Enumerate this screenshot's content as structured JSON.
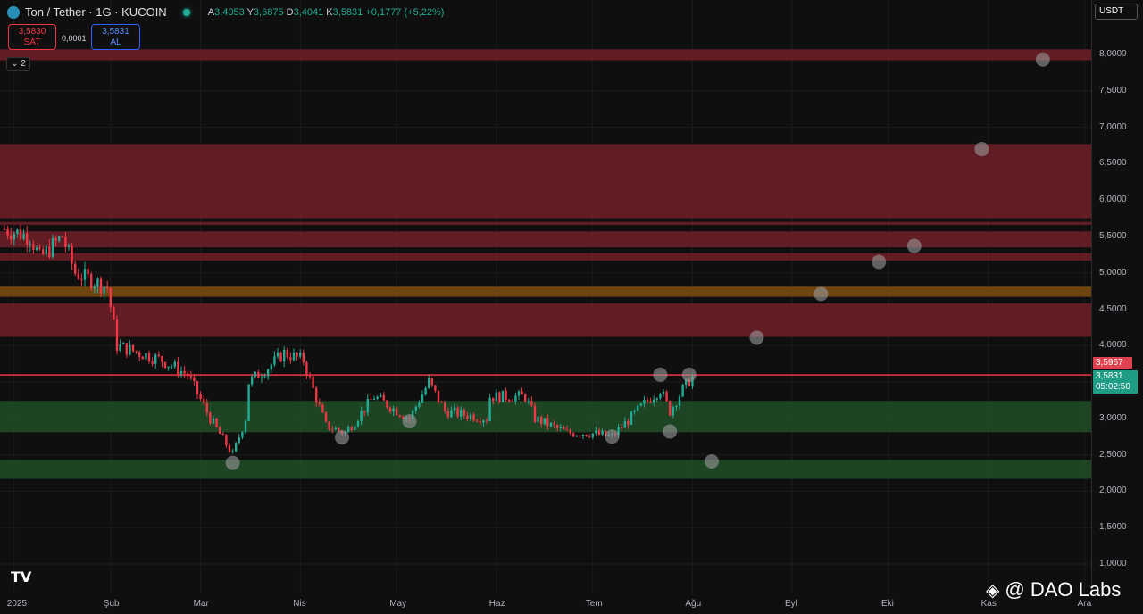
{
  "header": {
    "symbol": "Ton / Tether · 1G · KUCOIN",
    "open_label": "A",
    "open": "3,4053",
    "high_label": "Y",
    "high": "3,6875",
    "low_label": "D",
    "low": "3,4041",
    "close_label": "K",
    "close": "3,5831",
    "change": "+0,1777 (+5,22%)"
  },
  "trade": {
    "sell_price": "3,5830",
    "sell_label": "SAT",
    "spread": "0,0001",
    "buy_price": "3,5831",
    "buy_label": "AL"
  },
  "indicators_toggle": "2",
  "currency": "USDT",
  "price_tags": {
    "line": "3,5967",
    "last": "3,5831",
    "countdown": "05:02:50"
  },
  "watermark": "@ DAO Labs",
  "colors": {
    "up": "#22ab94",
    "down": "#f23645",
    "red_zone": "#6b1f27",
    "green_zone": "#1f4a26",
    "orange_zone": "#7a4a10"
  },
  "chart_data": {
    "type": "candlestick",
    "y_ticks": [
      "8,0000",
      "7,5000",
      "7,0000",
      "6,5000",
      "6,0000",
      "5,5000",
      "5,0000",
      "4,5000",
      "4,0000",
      "3,5000",
      "3,0000",
      "2,5000",
      "2,0000",
      "1,5000",
      "1,0000"
    ],
    "ylim": [
      1.0,
      8.0
    ],
    "x_ticks": [
      {
        "label": "2025",
        "day": 3
      },
      {
        "label": "Şub",
        "day": 33
      },
      {
        "label": "Mar",
        "day": 61
      },
      {
        "label": "Nis",
        "day": 92
      },
      {
        "label": "May",
        "day": 122
      },
      {
        "label": "Haz",
        "day": 153
      },
      {
        "label": "Tem",
        "day": 183
      },
      {
        "label": "Ağu",
        "day": 214
      },
      {
        "label": "Eyl",
        "day": 245
      },
      {
        "label": "Eki",
        "day": 275
      },
      {
        "label": "Kas",
        "day": 306
      },
      {
        "label": "Ara",
        "day": 336
      }
    ],
    "path": [
      [
        0,
        5.6
      ],
      [
        8,
        5.5
      ],
      [
        11,
        5.2
      ],
      [
        18,
        5.5
      ],
      [
        22,
        5.0
      ],
      [
        32,
        4.8
      ],
      [
        35,
        4.0
      ],
      [
        49,
        3.8
      ],
      [
        57,
        3.6
      ],
      [
        64,
        3.0
      ],
      [
        71,
        2.5
      ],
      [
        75,
        3.0
      ],
      [
        76,
        3.5
      ],
      [
        82,
        3.7
      ],
      [
        87,
        3.9
      ],
      [
        93,
        3.8
      ],
      [
        96,
        3.4
      ],
      [
        100,
        2.9
      ],
      [
        106,
        2.8
      ],
      [
        115,
        3.3
      ],
      [
        126,
        3.0
      ],
      [
        132,
        3.5
      ],
      [
        137,
        3.1
      ],
      [
        150,
        3.0
      ],
      [
        151,
        3.3
      ],
      [
        162,
        3.3
      ],
      [
        165,
        3.0
      ],
      [
        175,
        2.8
      ],
      [
        182,
        2.8
      ],
      [
        189,
        2.75
      ],
      [
        199,
        3.2
      ],
      [
        204,
        3.4
      ],
      [
        207,
        3.1
      ],
      [
        211,
        3.4
      ],
      [
        214,
        3.58
      ]
    ],
    "zones": [
      {
        "kind": "red",
        "from": 7.92,
        "to": 8.07
      },
      {
        "kind": "red",
        "from": 5.75,
        "to": 6.77
      },
      {
        "kind": "red",
        "from": 5.66,
        "to": 5.7
      },
      {
        "kind": "red",
        "from": 5.35,
        "to": 5.57
      },
      {
        "kind": "red",
        "from": 5.17,
        "to": 5.27
      },
      {
        "kind": "orange",
        "from": 4.67,
        "to": 4.81
      },
      {
        "kind": "red",
        "from": 4.12,
        "to": 4.58
      },
      {
        "kind": "green",
        "from": 2.81,
        "to": 3.24
      },
      {
        "kind": "green",
        "from": 2.17,
        "to": 2.43
      }
    ],
    "line_level": 3.5967,
    "markers": [
      [
        71,
        2.39
      ],
      [
        105,
        2.74
      ],
      [
        126,
        2.96
      ],
      [
        189,
        2.75
      ],
      [
        204,
        3.6
      ],
      [
        207,
        2.82
      ],
      [
        213,
        3.6
      ],
      [
        220,
        2.41
      ],
      [
        234,
        4.11
      ],
      [
        254,
        4.71
      ],
      [
        272,
        5.15
      ],
      [
        283,
        5.37
      ],
      [
        304,
        6.7
      ],
      [
        323,
        7.93
      ]
    ]
  }
}
